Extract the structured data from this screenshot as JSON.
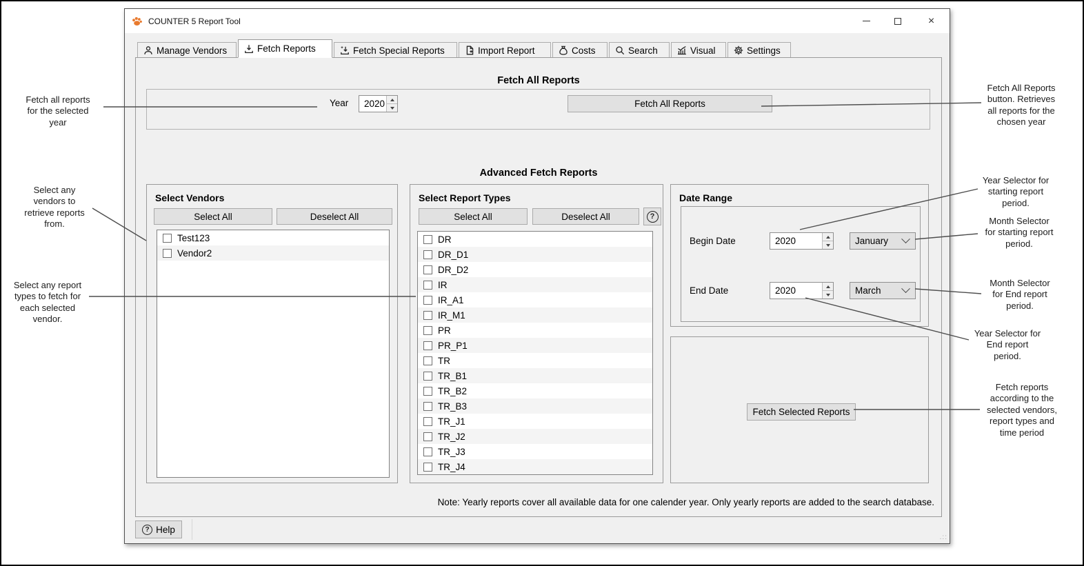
{
  "window": {
    "title": "COUNTER 5 Report Tool",
    "controls": [
      "minimize",
      "maximize",
      "close"
    ]
  },
  "tabs": [
    {
      "label": "Manage Vendors",
      "icon": "person-icon",
      "active": false
    },
    {
      "label": "Fetch Reports",
      "icon": "download-icon",
      "active": true
    },
    {
      "label": "Fetch Special Reports",
      "icon": "download-star-icon",
      "active": false
    },
    {
      "label": "Import Report",
      "icon": "document-plus-icon",
      "active": false
    },
    {
      "label": "Costs",
      "icon": "money-bag-icon",
      "active": false
    },
    {
      "label": "Search",
      "icon": "search-icon",
      "active": false
    },
    {
      "label": "Visual",
      "icon": "chart-icon",
      "active": false
    },
    {
      "label": "Settings",
      "icon": "gear-icon",
      "active": false
    }
  ],
  "fetch_all": {
    "section_title": "Fetch All Reports",
    "year_label": "Year",
    "year_value": "2020",
    "button_label": "Fetch All Reports"
  },
  "advanced": {
    "section_title": "Advanced Fetch Reports",
    "vendors": {
      "title": "Select Vendors",
      "select_all": "Select All",
      "deselect_all": "Deselect All",
      "items": [
        {
          "label": "Test123",
          "checked": false
        },
        {
          "label": "Vendor2",
          "checked": false
        }
      ]
    },
    "report_types": {
      "title": "Select Report Types",
      "select_all": "Select All",
      "deselect_all": "Deselect All",
      "help_icon": "?",
      "items": [
        {
          "label": "DR",
          "checked": false
        },
        {
          "label": "DR_D1",
          "checked": false
        },
        {
          "label": "DR_D2",
          "checked": false
        },
        {
          "label": "IR",
          "checked": false
        },
        {
          "label": "IR_A1",
          "checked": false
        },
        {
          "label": "IR_M1",
          "checked": false
        },
        {
          "label": "PR",
          "checked": false
        },
        {
          "label": "PR_P1",
          "checked": false
        },
        {
          "label": "TR",
          "checked": false
        },
        {
          "label": "TR_B1",
          "checked": false
        },
        {
          "label": "TR_B2",
          "checked": false
        },
        {
          "label": "TR_B3",
          "checked": false
        },
        {
          "label": "TR_J1",
          "checked": false
        },
        {
          "label": "TR_J2",
          "checked": false
        },
        {
          "label": "TR_J3",
          "checked": false
        },
        {
          "label": "TR_J4",
          "checked": false
        }
      ]
    },
    "date_range": {
      "title": "Date Range",
      "begin_label": "Begin Date",
      "begin_year": "2020",
      "begin_month": "January",
      "end_label": "End Date",
      "end_year": "2020",
      "end_month": "March"
    },
    "fetch_selected_label": "Fetch Selected Reports"
  },
  "note": "Note: Yearly reports cover all available data for one calender year. Only yearly reports are added to the search database.",
  "help": {
    "label": "Help",
    "icon": "?"
  },
  "annotations": {
    "left": [
      {
        "text": "Fetch all reports\nfor the selected\nyear"
      },
      {
        "text": "Select any\nvendors to\nretrieve reports\nfrom."
      },
      {
        "text": "Select any report\ntypes to fetch for\neach selected\nvendor."
      }
    ],
    "right": [
      {
        "text": "Fetch All Reports\nbutton. Retrieves\nall reports for the\nchosen year"
      },
      {
        "text": "Year Selector for\nstarting report\nperiod."
      },
      {
        "text": "Month Selector\nfor starting report\nperiod."
      },
      {
        "text": "Month Selector\nfor End report\nperiod."
      },
      {
        "text": "Year Selector for\nEnd report\nperiod."
      },
      {
        "text": "Fetch reports\naccording to the\nselected vendors,\nreport types and\ntime period"
      }
    ]
  },
  "colors": {
    "accent_orange": "#e87a2e",
    "button_bg": "#e1e1e1",
    "row_alt": "#f4f4f4",
    "border_gray": "#9a9a9a"
  }
}
